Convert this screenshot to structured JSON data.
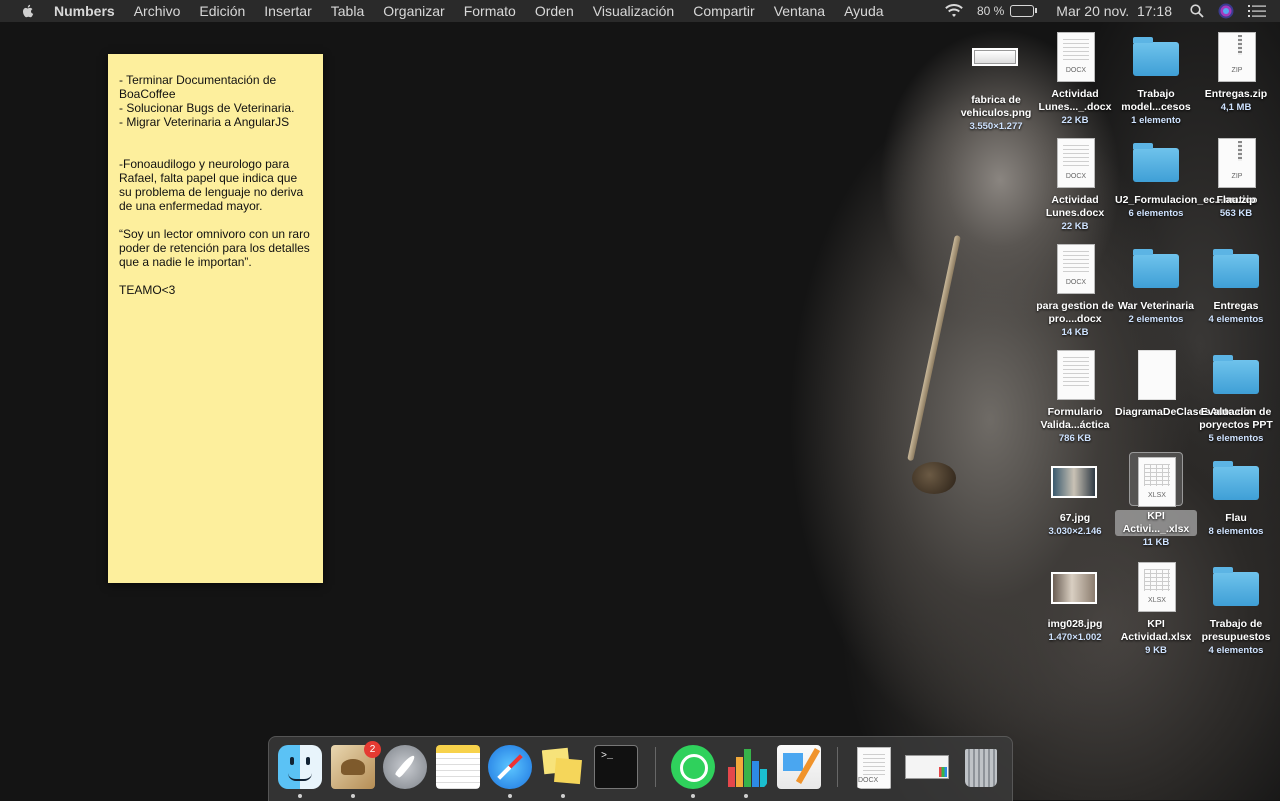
{
  "menubar": {
    "app_name": "Numbers",
    "items": [
      "Archivo",
      "Edición",
      "Insertar",
      "Tabla",
      "Organizar",
      "Formato",
      "Orden",
      "Visualización",
      "Compartir",
      "Ventana",
      "Ayuda"
    ],
    "battery": "80 %",
    "date_time": "Mar 20 nov.  17:18"
  },
  "sticky_note": {
    "text": "- Terminar Documentación de BoaCoffee\n- Solucionar Bugs de Veterinaria.\n- Migrar Veterinaria a AngularJS\n\n\n-Fonoaudilogo y neurologo para Rafael, falta papel que indica que su problema de lenguaje no deriva de una enfermedad mayor.\n\n“Soy un lector omnivoro con un raro poder de retención para los detalles que a nadie le importan”.\n\nTEAMO<3"
  },
  "desktop_icons": [
    {
      "name": "fabrica de vehiculos.png",
      "meta": "3.550×1.277",
      "kind": "image"
    },
    {
      "name": "Actividad Lunes..._.docx",
      "meta": "22 KB",
      "kind": "docx"
    },
    {
      "name": "Trabajo model...cesos",
      "meta": "1 elemento",
      "kind": "folder"
    },
    {
      "name": "Entregas.zip",
      "meta": "4,1 MB",
      "kind": "zip"
    },
    {
      "name": "Actividad Lunes.docx",
      "meta": "22 KB",
      "kind": "docx"
    },
    {
      "name": "U2_Formulacion_ec...matico",
      "meta": "6 elementos",
      "kind": "folder"
    },
    {
      "name": "Flau.zip",
      "meta": "563 KB",
      "kind": "zip"
    },
    {
      "name": "para gestion de pro....docx",
      "meta": "14 KB",
      "kind": "docx"
    },
    {
      "name": "War Veterinaria",
      "meta": "2 elementos",
      "kind": "folder"
    },
    {
      "name": "Entregas",
      "meta": "4 elementos",
      "kind": "folder"
    },
    {
      "name": "Formulario Valida...áctica",
      "meta": "786 KB",
      "kind": "doc"
    },
    {
      "name": "DiagramaDeClasesAuto.dia",
      "meta": "",
      "kind": "blank"
    },
    {
      "name": "Evaluacion de poryectos PPT",
      "meta": "5 elementos",
      "kind": "folder"
    },
    {
      "name": "67.jpg",
      "meta": "3.030×2.146",
      "kind": "image"
    },
    {
      "name": "KPI Activi..._.xlsx",
      "meta": "11 KB",
      "kind": "xlsx"
    },
    {
      "name": "Flau",
      "meta": "8 elementos",
      "kind": "folder"
    },
    {
      "name": "img028.jpg",
      "meta": "1.470×1.002",
      "kind": "image"
    },
    {
      "name": "KPI Actividad.xlsx",
      "meta": "9 KB",
      "kind": "xlsx"
    },
    {
      "name": "Trabajo de presupuestos",
      "meta": "4 elementos",
      "kind": "folder"
    }
  ],
  "file_tags": {
    "docx": "DOCX",
    "zip": "ZIP",
    "xlsx": "XLSX"
  },
  "dock": {
    "mail_badge": "2",
    "apps": [
      "finder-icon",
      "mail-icon",
      "launchpad-icon",
      "notes-icon",
      "safari-icon",
      "stickies-icon",
      "terminal-icon",
      "whatsapp-icon",
      "numbers-icon",
      "pages-icon",
      "recent-docx-icon",
      "recent-window-icon",
      "trash-icon"
    ]
  }
}
